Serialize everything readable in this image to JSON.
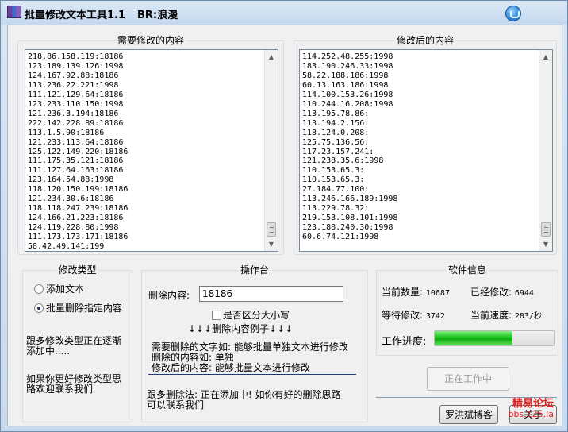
{
  "window": {
    "title": "批量修改文本工具1.1",
    "author": "BR:浪漫"
  },
  "panels": {
    "before": {
      "title": "需要修改的内容",
      "lines": [
        "218.86.158.119:18186",
        "123.189.139.126:1998",
        "124.167.92.88:18186",
        "113.236.22.221:1998",
        "111.121.129.64:18186",
        "123.233.110.150:1998",
        "121.236.3.194:18186",
        "222.142.228.89:18186",
        "113.1.5.90:18186",
        "121.233.113.64:18186",
        "125.122.149.220:18186",
        "111.175.35.121:18186",
        "111.127.64.163:18186",
        "123.164.54.88:1998",
        "118.120.150.199:18186",
        "121.234.30.6:18186",
        "118.118.247.239:18186",
        "124.166.21.223:18186",
        "124.119.228.80:1998",
        "111.173.173.171:18186",
        "58.42.49.141:199"
      ]
    },
    "after": {
      "title": "修改后的内容",
      "lines": [
        "114.252.48.255:1998",
        "183.190.246.33:1998",
        "58.22.188.186:1998",
        "60.13.163.186:1998",
        "114.100.153.26:1998",
        "110.244.16.208:1998",
        "113.195.78.86:",
        "113.194.2.156:",
        "118.124.0.208:",
        "125.75.136.56:",
        "117.23.157.241:",
        "121.238.35.6:1998",
        "110.153.65.3:",
        "110.153.65.3:",
        "27.184.77.100:",
        "113.246.166.189:1998",
        "113.229.78.32:",
        "219.153.108.101:1998",
        "123.188.240.30:1998",
        "60.6.74.121:1998"
      ]
    }
  },
  "modify_type": {
    "title": "修改类型",
    "options": [
      {
        "label": "添加文本",
        "selected": false
      },
      {
        "label": "批量删除指定内容",
        "selected": true
      }
    ],
    "note1_line1": "跟多修改类型正在逐渐",
    "note1_line2": "添加中.....",
    "note2_line1": "如果你更好修改类型思",
    "note2_line2": "路欢迎联系我们"
  },
  "console": {
    "title": "操作台",
    "delete_label": "删除内容:",
    "delete_value": "18186",
    "case_label": "是否区分大小写",
    "example_heading": "↓↓↓删除内容例子↓↓↓",
    "example_line1": "需要删除的文字如: 能够批量单独文本进行修改",
    "example_line2": "删除的内容如: 单独",
    "example_line3": "修改后的内容: 能够批量文本进行修改",
    "footer_line1": "跟多删除法: 正在添加中! 如你有好的删除思路",
    "footer_line2": "可以联系我们"
  },
  "info": {
    "title": "软件信息",
    "current_count_label": "当前数量:",
    "current_count": "10687",
    "modified_label": "已经修改:",
    "modified": "6944",
    "waiting_label": "等待修改:",
    "waiting": "3742",
    "speed_label": "当前速度:",
    "speed": "283/秒",
    "progress_label": "工作进度:",
    "progress_fraction": 0.65,
    "working_button": "正在工作中",
    "blog_button": "罗洪斌博客",
    "about_button": "关于"
  },
  "watermark": {
    "line1": "精易论坛",
    "line2": "bbs.125.la"
  }
}
